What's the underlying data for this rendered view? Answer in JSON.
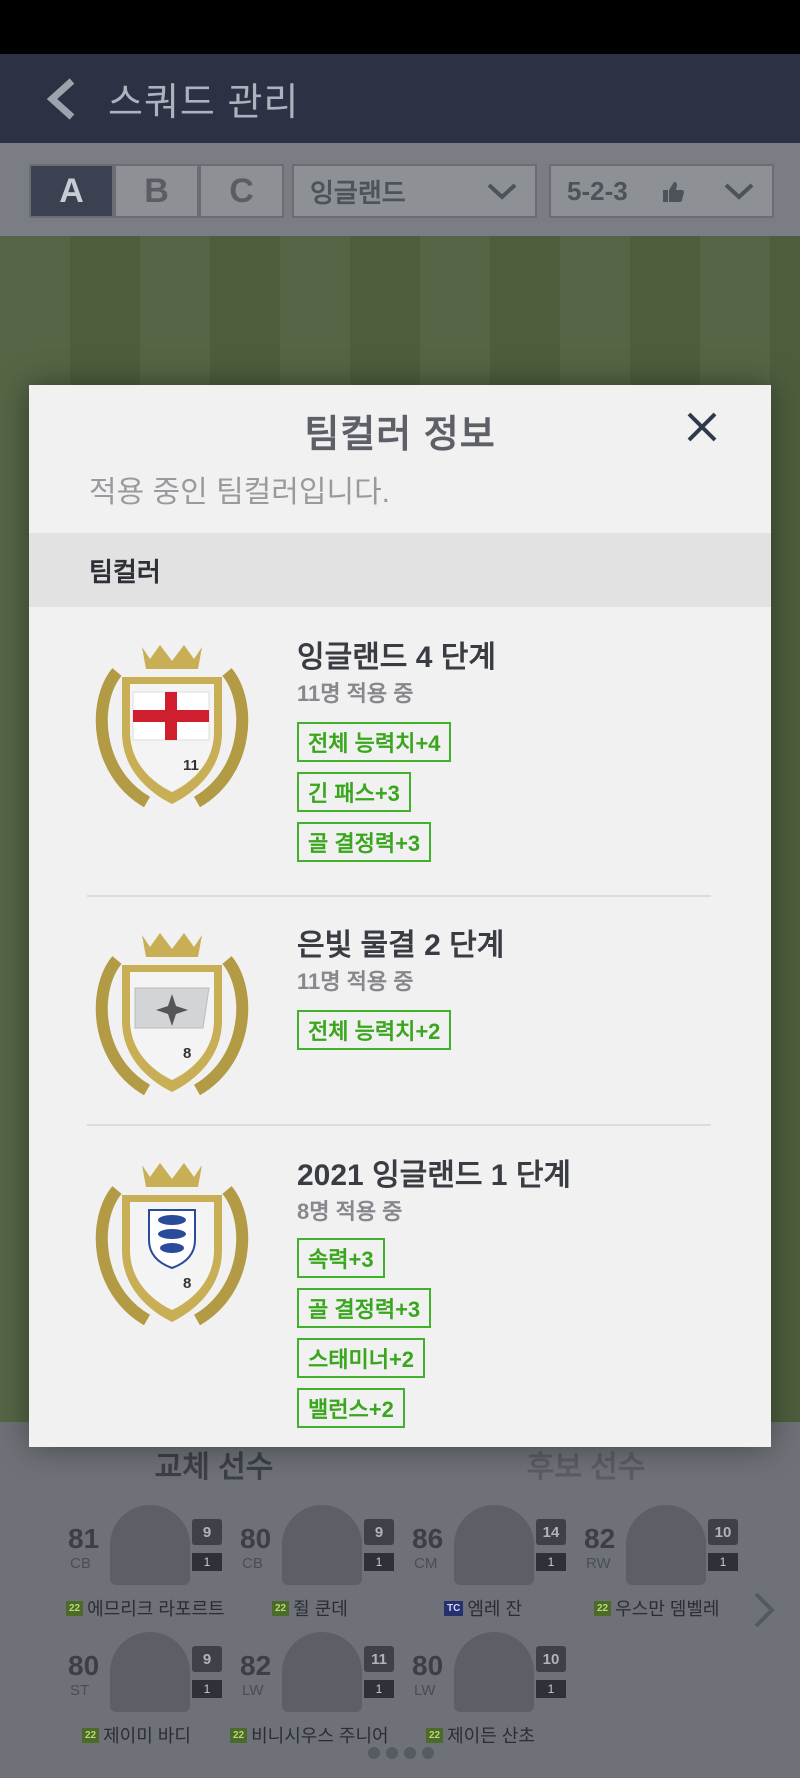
{
  "header": {
    "title": "스쿼드 관리"
  },
  "squad_tabs": [
    "A",
    "B",
    "C"
  ],
  "team_select": {
    "value": "잉글랜드"
  },
  "formation_select": {
    "value": "5-2-3"
  },
  "bench": {
    "tabs": [
      "교체 선수",
      "후보 선수"
    ],
    "players": [
      {
        "ovr": "81",
        "pos": "CB",
        "num": "9",
        "level": "1",
        "season": "22",
        "name": "에므리크 라포르트"
      },
      {
        "ovr": "80",
        "pos": "CB",
        "num": "9",
        "level": "1",
        "season": "22",
        "name": "쥘 쿤데"
      },
      {
        "ovr": "86",
        "pos": "CM",
        "num": "14",
        "level": "1",
        "season": "TC",
        "name": "엠레 잔"
      },
      {
        "ovr": "82",
        "pos": "RW",
        "num": "10",
        "level": "1",
        "season": "22",
        "name": "우스만 뎀벨레"
      },
      {
        "ovr": "80",
        "pos": "ST",
        "num": "9",
        "level": "1",
        "season": "22",
        "name": "제이미 바디"
      },
      {
        "ovr": "82",
        "pos": "LW",
        "num": "11",
        "level": "1",
        "season": "22",
        "name": "비니시우스 주니어"
      },
      {
        "ovr": "80",
        "pos": "LW",
        "num": "10",
        "level": "1",
        "season": "22",
        "name": "제이든 산초"
      }
    ]
  },
  "modal": {
    "title": "팀컬러 정보",
    "subtitle": "적용 중인 팀컬러입니다.",
    "section": "팀컬러",
    "teamcolors": [
      {
        "name": "잉글랜드 4 단계",
        "count": "11명 적용 중",
        "badge": "england-flag",
        "badge_number": "11",
        "bonuses": [
          "전체 능력치+4",
          "긴 패스+3",
          "골 결정력+3"
        ]
      },
      {
        "name": "은빛 물결 2 단계",
        "count": "11명 적용 중",
        "badge": "silver-wave",
        "badge_number": "8",
        "bonuses": [
          "전체 능력치+2"
        ]
      },
      {
        "name": "2021 잉글랜드 1 단계",
        "count": "8명 적용 중",
        "badge": "three-lions",
        "badge_number": "8",
        "bonuses": [
          "속력+3",
          "골 결정력+3",
          "스태미너+2",
          "밸런스+2"
        ]
      }
    ]
  },
  "colors": {
    "header": "#2c3244",
    "bonus_green": "#3aa61e",
    "modal_bg": "#f1f1f1"
  }
}
